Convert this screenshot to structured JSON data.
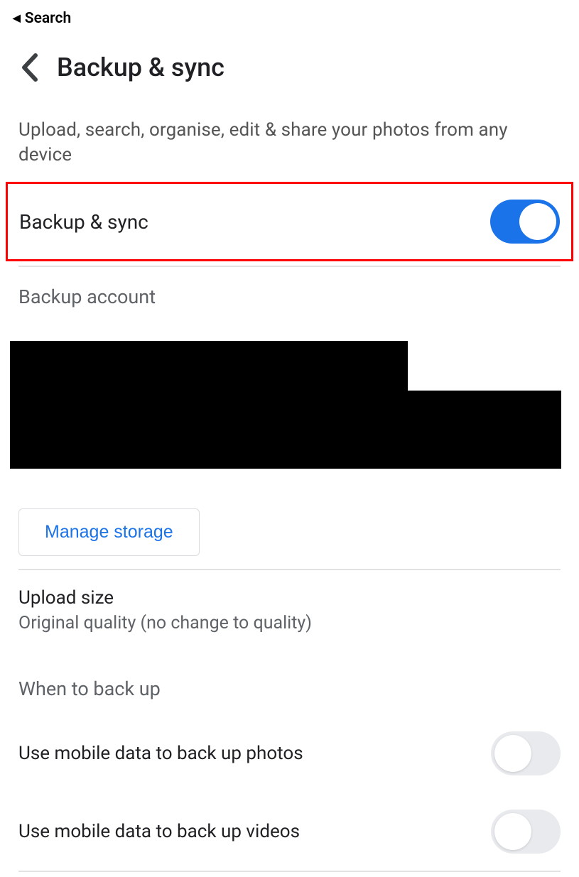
{
  "breadcrumb": {
    "label": "Search"
  },
  "header": {
    "title": "Backup & sync"
  },
  "description": "Upload, search, organise, edit & share your photos from any device",
  "toggle_main": {
    "label": "Backup & sync",
    "enabled": true
  },
  "backup_account": {
    "label": "Backup account"
  },
  "manage_storage_label": "Manage storage",
  "upload_size": {
    "title": "Upload size",
    "subtitle": "Original quality (no change to quality)"
  },
  "when_to_backup": {
    "heading": "When to back up",
    "options": [
      {
        "label": "Use mobile data to back up photos",
        "enabled": false
      },
      {
        "label": "Use mobile data to back up videos",
        "enabled": false
      }
    ]
  }
}
